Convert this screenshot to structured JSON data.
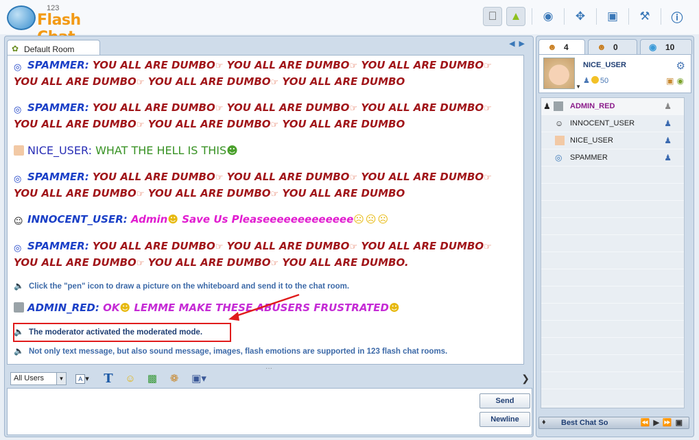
{
  "app": {
    "logo_number": "123",
    "logo_name": "Flash Chat"
  },
  "top_icons": [
    "apple-icon",
    "android-icon",
    "webcam-icon",
    "gamepad-icon",
    "gift-icon",
    "wrench-icon",
    "info-icon"
  ],
  "room_tab": {
    "label": "Default Room"
  },
  "messages": [
    {
      "user": "SPAMMER",
      "line1": "YOU ALL ARE DUMBO",
      "repeat": "YOU ALL ARE DUMBO",
      "line2": "YOU ALL ARE DUMBO",
      "end": "YOU ALL ARE DUMBO"
    },
    {
      "user": "NICE_USER",
      "text": "WHAT THE HELL IS THIS"
    },
    {
      "user": "INNOCENT_USER",
      "text": "Admin",
      "text2": "Save Us Pleaseeeeeeeeeeeee"
    },
    {
      "user": "ADMIN_RED",
      "text": "OK",
      "text2": "LEMME MAKE THESE ABUSERS FRUSTRATED"
    }
  ],
  "last_spam_end": "YOU ALL ARE DUMBO.",
  "system": {
    "pen_tip": "Click the \"pen\" icon to draw a picture on the whiteboard and send it to the chat room.",
    "moderated": "The moderator activated the moderated mode.",
    "features": "Not only text message, but also sound message, images, flash emotions are supported in 123 flash chat rooms."
  },
  "toolbar": {
    "recipient": "All Users"
  },
  "buttons": {
    "send": "Send",
    "newline": "Newline"
  },
  "side_tabs": [
    {
      "count": "4"
    },
    {
      "count": "0"
    },
    {
      "count": "10"
    }
  ],
  "profile": {
    "name": "NICE_USER",
    "points": "50"
  },
  "users": [
    {
      "name": "ADMIN_RED"
    },
    {
      "name": "INNOCENT_USER"
    },
    {
      "name": "NICE_USER"
    },
    {
      "name": "SPAMMER"
    }
  ],
  "bottombar": {
    "label": "Best Chat So"
  }
}
